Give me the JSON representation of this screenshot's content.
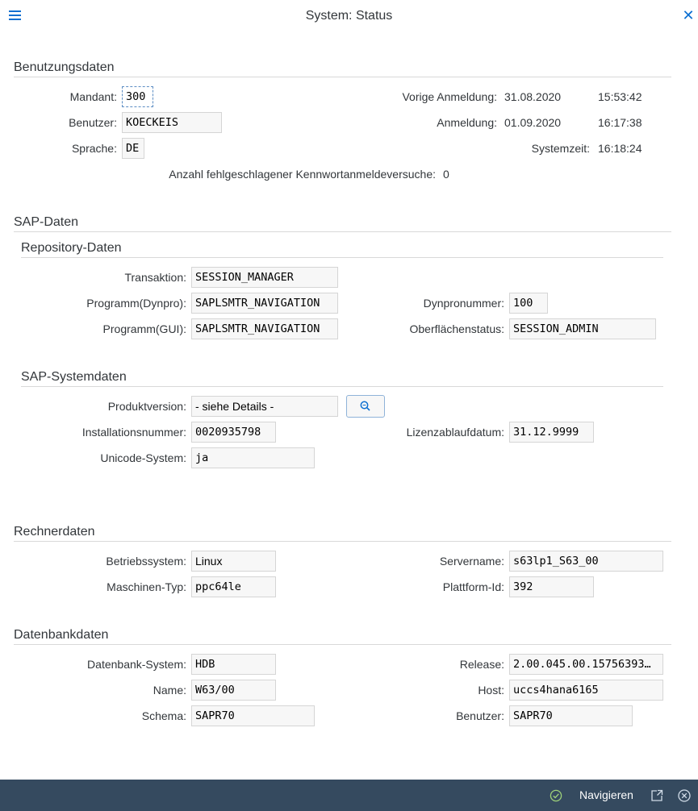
{
  "header": {
    "title": "System: Status",
    "menu_icon": "hamburger-menu-icon",
    "close_icon": "close-icon"
  },
  "usage": {
    "title": "Benutzungsdaten",
    "client_label": "Mandant:",
    "client_value": "300",
    "user_label": "Benutzer:",
    "user_value": "KOECKEIS",
    "language_label": "Sprache:",
    "language_value": "DE",
    "failed_logons_label": "Anzahl fehlgeschlagener Kennwortanmeldeversuche:",
    "failed_logons_value": "0",
    "prev_logon_label": "Vorige Anmeldung:",
    "prev_logon_date": "31.08.2020",
    "prev_logon_time": "15:53:42",
    "logon_label": "Anmeldung:",
    "logon_date": "01.09.2020",
    "logon_time": "16:17:38",
    "systime_label": "Systemzeit:",
    "systime_value": "16:18:24"
  },
  "sap": {
    "title": "SAP-Daten",
    "repository": {
      "title": "Repository-Daten",
      "transaction_label": "Transaktion:",
      "transaction_value": "SESSION_MANAGER",
      "program_dynpro_label": "Programm(Dynpro):",
      "program_dynpro_value": "SAPLSMTR_NAVIGATION",
      "program_gui_label": "Programm(GUI):",
      "program_gui_value": "SAPLSMTR_NAVIGATION",
      "dynpro_no_label": "Dynpronummer:",
      "dynpro_no_value": "100",
      "gui_status_label": "Oberflächenstatus:",
      "gui_status_value": "SESSION_ADMIN"
    },
    "system": {
      "title": "SAP-Systemdaten",
      "product_label": "Produktversion:",
      "product_value": "- siehe Details -",
      "details_icon": "magnifier-icon",
      "install_label": "Installationsnummer:",
      "install_value": "0020935798",
      "license_label": "Lizenzablaufdatum:",
      "license_value": "31.12.9999",
      "unicode_label": "Unicode-System:",
      "unicode_value": "ja"
    }
  },
  "host": {
    "title": "Rechnerdaten",
    "os_label": "Betriebssystem:",
    "os_value": "Linux",
    "machine_label": "Maschinen-Typ:",
    "machine_value": "ppc64le",
    "server_label": "Servername:",
    "server_value": "s63lp1_S63_00",
    "platform_label": "Plattform-Id:",
    "platform_value": "392"
  },
  "db": {
    "title": "Datenbankdaten",
    "system_label": "Datenbank-System:",
    "system_value": "HDB",
    "name_label": "Name:",
    "name_value": "W63/00",
    "schema_label": "Schema:",
    "schema_value": "SAPR70",
    "release_label": "Release:",
    "release_value": "2.00.045.00.15756393…",
    "host_label": "Host:",
    "host_value": "uccs4hana6165",
    "user_label": "Benutzer:",
    "user_value": "SAPR70"
  },
  "footer": {
    "navigate_label": "Navigieren",
    "check_icon": "check-circle-icon",
    "export_icon": "share-icon",
    "cancel_icon": "cancel-circle-icon"
  }
}
